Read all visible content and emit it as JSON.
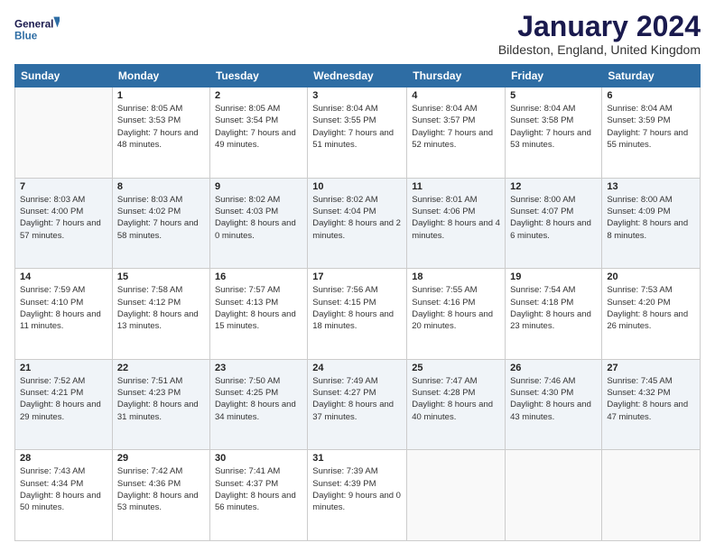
{
  "logo": {
    "line1": "General",
    "line2": "Blue"
  },
  "title": "January 2024",
  "location": "Bildeston, England, United Kingdom",
  "weekdays": [
    "Sunday",
    "Monday",
    "Tuesday",
    "Wednesday",
    "Thursday",
    "Friday",
    "Saturday"
  ],
  "weeks": [
    [
      {
        "day": "",
        "sunrise": "",
        "sunset": "",
        "daylight": ""
      },
      {
        "day": "1",
        "sunrise": "Sunrise: 8:05 AM",
        "sunset": "Sunset: 3:53 PM",
        "daylight": "Daylight: 7 hours and 48 minutes."
      },
      {
        "day": "2",
        "sunrise": "Sunrise: 8:05 AM",
        "sunset": "Sunset: 3:54 PM",
        "daylight": "Daylight: 7 hours and 49 minutes."
      },
      {
        "day": "3",
        "sunrise": "Sunrise: 8:04 AM",
        "sunset": "Sunset: 3:55 PM",
        "daylight": "Daylight: 7 hours and 51 minutes."
      },
      {
        "day": "4",
        "sunrise": "Sunrise: 8:04 AM",
        "sunset": "Sunset: 3:57 PM",
        "daylight": "Daylight: 7 hours and 52 minutes."
      },
      {
        "day": "5",
        "sunrise": "Sunrise: 8:04 AM",
        "sunset": "Sunset: 3:58 PM",
        "daylight": "Daylight: 7 hours and 53 minutes."
      },
      {
        "day": "6",
        "sunrise": "Sunrise: 8:04 AM",
        "sunset": "Sunset: 3:59 PM",
        "daylight": "Daylight: 7 hours and 55 minutes."
      }
    ],
    [
      {
        "day": "7",
        "sunrise": "Sunrise: 8:03 AM",
        "sunset": "Sunset: 4:00 PM",
        "daylight": "Daylight: 7 hours and 57 minutes."
      },
      {
        "day": "8",
        "sunrise": "Sunrise: 8:03 AM",
        "sunset": "Sunset: 4:02 PM",
        "daylight": "Daylight: 7 hours and 58 minutes."
      },
      {
        "day": "9",
        "sunrise": "Sunrise: 8:02 AM",
        "sunset": "Sunset: 4:03 PM",
        "daylight": "Daylight: 8 hours and 0 minutes."
      },
      {
        "day": "10",
        "sunrise": "Sunrise: 8:02 AM",
        "sunset": "Sunset: 4:04 PM",
        "daylight": "Daylight: 8 hours and 2 minutes."
      },
      {
        "day": "11",
        "sunrise": "Sunrise: 8:01 AM",
        "sunset": "Sunset: 4:06 PM",
        "daylight": "Daylight: 8 hours and 4 minutes."
      },
      {
        "day": "12",
        "sunrise": "Sunrise: 8:00 AM",
        "sunset": "Sunset: 4:07 PM",
        "daylight": "Daylight: 8 hours and 6 minutes."
      },
      {
        "day": "13",
        "sunrise": "Sunrise: 8:00 AM",
        "sunset": "Sunset: 4:09 PM",
        "daylight": "Daylight: 8 hours and 8 minutes."
      }
    ],
    [
      {
        "day": "14",
        "sunrise": "Sunrise: 7:59 AM",
        "sunset": "Sunset: 4:10 PM",
        "daylight": "Daylight: 8 hours and 11 minutes."
      },
      {
        "day": "15",
        "sunrise": "Sunrise: 7:58 AM",
        "sunset": "Sunset: 4:12 PM",
        "daylight": "Daylight: 8 hours and 13 minutes."
      },
      {
        "day": "16",
        "sunrise": "Sunrise: 7:57 AM",
        "sunset": "Sunset: 4:13 PM",
        "daylight": "Daylight: 8 hours and 15 minutes."
      },
      {
        "day": "17",
        "sunrise": "Sunrise: 7:56 AM",
        "sunset": "Sunset: 4:15 PM",
        "daylight": "Daylight: 8 hours and 18 minutes."
      },
      {
        "day": "18",
        "sunrise": "Sunrise: 7:55 AM",
        "sunset": "Sunset: 4:16 PM",
        "daylight": "Daylight: 8 hours and 20 minutes."
      },
      {
        "day": "19",
        "sunrise": "Sunrise: 7:54 AM",
        "sunset": "Sunset: 4:18 PM",
        "daylight": "Daylight: 8 hours and 23 minutes."
      },
      {
        "day": "20",
        "sunrise": "Sunrise: 7:53 AM",
        "sunset": "Sunset: 4:20 PM",
        "daylight": "Daylight: 8 hours and 26 minutes."
      }
    ],
    [
      {
        "day": "21",
        "sunrise": "Sunrise: 7:52 AM",
        "sunset": "Sunset: 4:21 PM",
        "daylight": "Daylight: 8 hours and 29 minutes."
      },
      {
        "day": "22",
        "sunrise": "Sunrise: 7:51 AM",
        "sunset": "Sunset: 4:23 PM",
        "daylight": "Daylight: 8 hours and 31 minutes."
      },
      {
        "day": "23",
        "sunrise": "Sunrise: 7:50 AM",
        "sunset": "Sunset: 4:25 PM",
        "daylight": "Daylight: 8 hours and 34 minutes."
      },
      {
        "day": "24",
        "sunrise": "Sunrise: 7:49 AM",
        "sunset": "Sunset: 4:27 PM",
        "daylight": "Daylight: 8 hours and 37 minutes."
      },
      {
        "day": "25",
        "sunrise": "Sunrise: 7:47 AM",
        "sunset": "Sunset: 4:28 PM",
        "daylight": "Daylight: 8 hours and 40 minutes."
      },
      {
        "day": "26",
        "sunrise": "Sunrise: 7:46 AM",
        "sunset": "Sunset: 4:30 PM",
        "daylight": "Daylight: 8 hours and 43 minutes."
      },
      {
        "day": "27",
        "sunrise": "Sunrise: 7:45 AM",
        "sunset": "Sunset: 4:32 PM",
        "daylight": "Daylight: 8 hours and 47 minutes."
      }
    ],
    [
      {
        "day": "28",
        "sunrise": "Sunrise: 7:43 AM",
        "sunset": "Sunset: 4:34 PM",
        "daylight": "Daylight: 8 hours and 50 minutes."
      },
      {
        "day": "29",
        "sunrise": "Sunrise: 7:42 AM",
        "sunset": "Sunset: 4:36 PM",
        "daylight": "Daylight: 8 hours and 53 minutes."
      },
      {
        "day": "30",
        "sunrise": "Sunrise: 7:41 AM",
        "sunset": "Sunset: 4:37 PM",
        "daylight": "Daylight: 8 hours and 56 minutes."
      },
      {
        "day": "31",
        "sunrise": "Sunrise: 7:39 AM",
        "sunset": "Sunset: 4:39 PM",
        "daylight": "Daylight: 9 hours and 0 minutes."
      },
      {
        "day": "",
        "sunrise": "",
        "sunset": "",
        "daylight": ""
      },
      {
        "day": "",
        "sunrise": "",
        "sunset": "",
        "daylight": ""
      },
      {
        "day": "",
        "sunrise": "",
        "sunset": "",
        "daylight": ""
      }
    ]
  ]
}
